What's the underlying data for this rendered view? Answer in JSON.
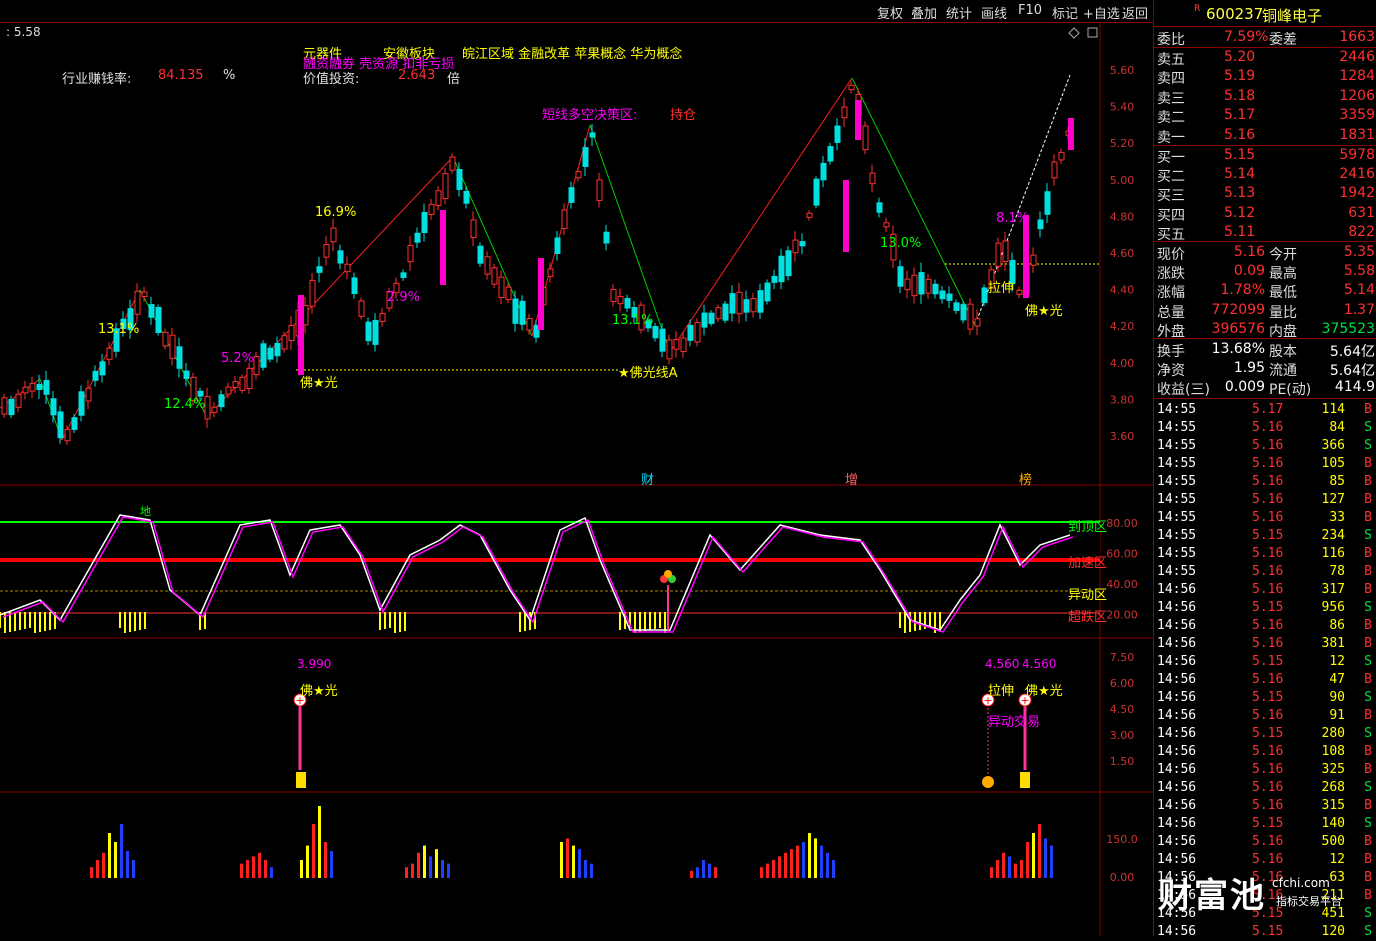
{
  "toolbar": {
    "buttons": [
      "复权",
      "叠加",
      "统计",
      "画线",
      "F10",
      "标记",
      "+自选",
      "返回"
    ]
  },
  "price_readout": ": 5.58",
  "overlay": {
    "industry_label": "行业赚钱率:",
    "industry_value": "84.135",
    "industry_unit": "%",
    "concept1": "元器件",
    "concept2": "安徽板块",
    "concept3": "皖江区域 金融改革 苹果概念 华为概念",
    "concept4": "融资融券 壳资源 扣非亏损",
    "value_label": "价值投资:",
    "value_value": "2.643",
    "value_unit": "倍",
    "decision_label": "短线多空决策区:",
    "decision_value": "持仓",
    "fo_guang": "佛★光",
    "fo_guang_line": "★佛光线A",
    "la_shen": "拉伸",
    "pct_labels": [
      "13.1%",
      "16.9%",
      "12.4%",
      "5.2%",
      "2.9%",
      "13.1%",
      "13.0%",
      "8.1%"
    ],
    "event_cai": "财",
    "event_zeng": "增",
    "event_bang": "榜"
  },
  "price_axis": [
    "5.60",
    "5.40",
    "5.20",
    "5.00",
    "4.80",
    "4.60",
    "4.40",
    "4.20",
    "4.00",
    "3.80",
    "3.60"
  ],
  "osc_axis": [
    "80.00",
    "60.00",
    "40.00",
    "20.00"
  ],
  "osc_zones": {
    "top": "到顶区",
    "accel": "加速区",
    "abnormal": "异动区",
    "oversold": "超跌区",
    "di": "地"
  },
  "signal_axis": [
    "7.50",
    "6.00",
    "4.50",
    "3.00",
    "1.50"
  ],
  "signal_labels": {
    "v1": "3.990",
    "v2": "4.560",
    "v3": "4.560",
    "fo1": "佛★光",
    "la": "拉伸",
    "fo2": "佛★光",
    "yidong": "异动交易"
  },
  "vol_axis": [
    "150.0",
    "0.00"
  ],
  "stock": {
    "flag": "R",
    "code": "600237",
    "name": "铜峰电子"
  },
  "quote": {
    "weibi_label": "委比",
    "weibi": "7.59%",
    "weicha_label": "委差",
    "weicha": "1663",
    "asks": [
      {
        "label": "卖五",
        "price": "5.20",
        "vol": "2446"
      },
      {
        "label": "卖四",
        "price": "5.19",
        "vol": "1284"
      },
      {
        "label": "卖三",
        "price": "5.18",
        "vol": "1206"
      },
      {
        "label": "卖二",
        "price": "5.17",
        "vol": "3359"
      },
      {
        "label": "卖一",
        "price": "5.16",
        "vol": "1831"
      }
    ],
    "bids": [
      {
        "label": "买一",
        "price": "5.15",
        "vol": "5978"
      },
      {
        "label": "买二",
        "price": "5.14",
        "vol": "2416"
      },
      {
        "label": "买三",
        "price": "5.13",
        "vol": "1942"
      },
      {
        "label": "买四",
        "price": "5.12",
        "vol": "631"
      },
      {
        "label": "买五",
        "price": "5.11",
        "vol": "822"
      }
    ],
    "stats": [
      {
        "l1": "现价",
        "v1": "5.16",
        "l2": "今开",
        "v2": "5.35"
      },
      {
        "l1": "涨跌",
        "v1": "0.09",
        "l2": "最高",
        "v2": "5.58"
      },
      {
        "l1": "涨幅",
        "v1": "1.78%",
        "l2": "最低",
        "v2": "5.14"
      },
      {
        "l1": "总量",
        "v1": "772099",
        "l2": "量比",
        "v2": "1.37"
      },
      {
        "l1": "外盘",
        "v1": "396576",
        "l2": "内盘",
        "v2": "375523"
      }
    ],
    "fin": [
      {
        "l1": "换手",
        "v1": "13.68%",
        "l2": "股本",
        "v2": "5.64亿"
      },
      {
        "l1": "净资",
        "v1": "1.95",
        "l2": "流通",
        "v2": "5.64亿"
      },
      {
        "l1": "收益(三)",
        "v1": "0.009",
        "l2": "PE(动)",
        "v2": "414.9"
      }
    ]
  },
  "ticks": [
    [
      "14:55",
      "5.17",
      "114",
      "B"
    ],
    [
      "14:55",
      "5.16",
      "84",
      "S"
    ],
    [
      "14:55",
      "5.16",
      "366",
      "S"
    ],
    [
      "14:55",
      "5.16",
      "105",
      "B"
    ],
    [
      "14:55",
      "5.16",
      "85",
      "B"
    ],
    [
      "14:55",
      "5.16",
      "127",
      "B"
    ],
    [
      "14:55",
      "5.16",
      "33",
      "B"
    ],
    [
      "14:55",
      "5.15",
      "234",
      "S"
    ],
    [
      "14:55",
      "5.16",
      "116",
      "B"
    ],
    [
      "14:55",
      "5.16",
      "78",
      "B"
    ],
    [
      "14:56",
      "5.16",
      "317",
      "B"
    ],
    [
      "14:56",
      "5.15",
      "956",
      "S"
    ],
    [
      "14:56",
      "5.16",
      "86",
      "B"
    ],
    [
      "14:56",
      "5.16",
      "381",
      "B"
    ],
    [
      "14:56",
      "5.15",
      "12",
      "S"
    ],
    [
      "14:56",
      "5.16",
      "47",
      "B"
    ],
    [
      "14:56",
      "5.15",
      "90",
      "S"
    ],
    [
      "14:56",
      "5.16",
      "91",
      "B"
    ],
    [
      "14:56",
      "5.15",
      "280",
      "S"
    ],
    [
      "14:56",
      "5.16",
      "108",
      "B"
    ],
    [
      "14:56",
      "5.16",
      "325",
      "B"
    ],
    [
      "14:56",
      "5.16",
      "268",
      "S"
    ],
    [
      "14:56",
      "5.16",
      "315",
      "B"
    ],
    [
      "14:56",
      "5.15",
      "140",
      "S"
    ],
    [
      "14:56",
      "5.16",
      "500",
      "B"
    ],
    [
      "14:56",
      "5.16",
      "12",
      "B"
    ],
    [
      "14:56",
      "5.16",
      "63",
      "B"
    ],
    [
      "14:56",
      "5.16",
      "211",
      "B"
    ],
    [
      "14:56",
      "5.15",
      "451",
      "S"
    ],
    [
      "14:56",
      "5.15",
      "120",
      "S"
    ]
  ],
  "watermark": {
    "main": "财富池",
    "site": "cfchi.com",
    "slogan": "指标交易平台"
  },
  "colors": {
    "up": "#ff3030",
    "down": "#00e0e0",
    "accent": "#ffff00",
    "magenta": "#ff00ff",
    "label": "#e0e0e0"
  }
}
